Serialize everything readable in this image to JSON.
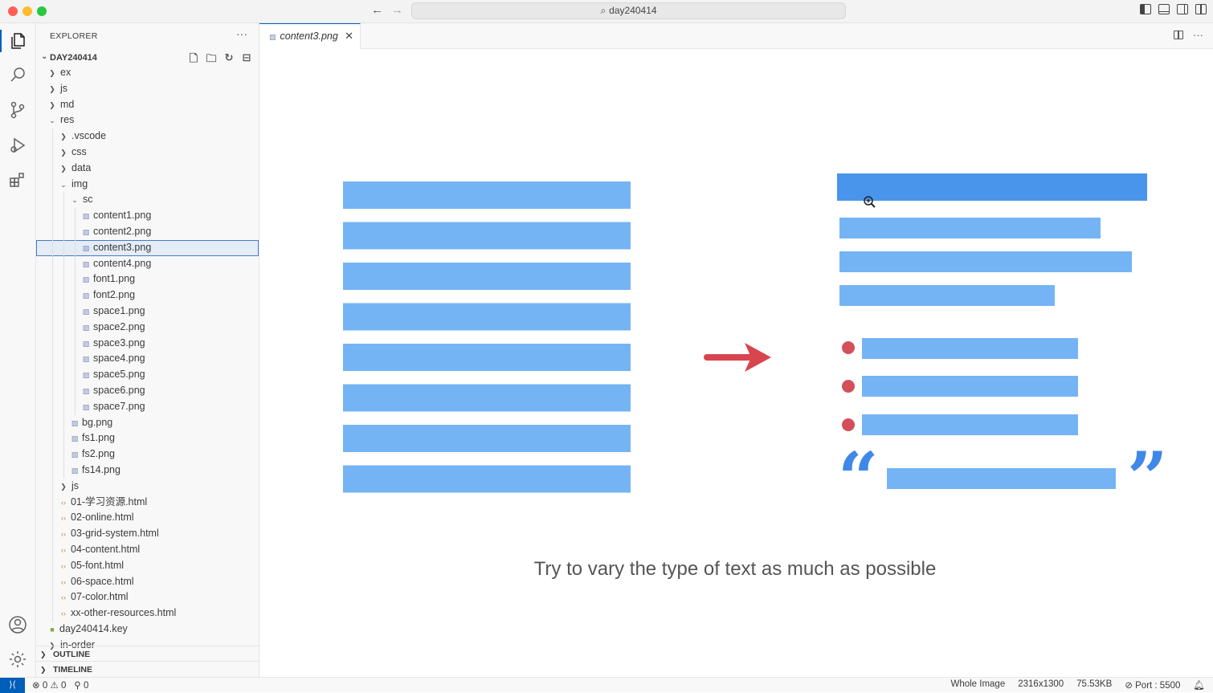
{
  "window": {
    "search_text": "day240414"
  },
  "explorer": {
    "header": "EXPLORER",
    "more": "···",
    "root_label": "DAY240414",
    "tree": [
      {
        "label": "ex",
        "depth": 1,
        "type": "folder",
        "expanded": false
      },
      {
        "label": "js",
        "depth": 1,
        "type": "folder",
        "expanded": false
      },
      {
        "label": "md",
        "depth": 1,
        "type": "folder",
        "expanded": false
      },
      {
        "label": "res",
        "depth": 1,
        "type": "folder",
        "expanded": true
      },
      {
        "label": ".vscode",
        "depth": 2,
        "type": "folder",
        "expanded": false
      },
      {
        "label": "css",
        "depth": 2,
        "type": "folder",
        "expanded": false
      },
      {
        "label": "data",
        "depth": 2,
        "type": "folder",
        "expanded": false
      },
      {
        "label": "img",
        "depth": 2,
        "type": "folder",
        "expanded": true
      },
      {
        "label": "sc",
        "depth": 3,
        "type": "folder",
        "expanded": true
      },
      {
        "label": "content1.png",
        "depth": 4,
        "type": "img"
      },
      {
        "label": "content2.png",
        "depth": 4,
        "type": "img"
      },
      {
        "label": "content3.png",
        "depth": 4,
        "type": "img",
        "selected": true
      },
      {
        "label": "content4.png",
        "depth": 4,
        "type": "img"
      },
      {
        "label": "font1.png",
        "depth": 4,
        "type": "img"
      },
      {
        "label": "font2.png",
        "depth": 4,
        "type": "img"
      },
      {
        "label": "space1.png",
        "depth": 4,
        "type": "img"
      },
      {
        "label": "space2.png",
        "depth": 4,
        "type": "img"
      },
      {
        "label": "space3.png",
        "depth": 4,
        "type": "img"
      },
      {
        "label": "space4.png",
        "depth": 4,
        "type": "img"
      },
      {
        "label": "space5.png",
        "depth": 4,
        "type": "img"
      },
      {
        "label": "space6.png",
        "depth": 4,
        "type": "img"
      },
      {
        "label": "space7.png",
        "depth": 4,
        "type": "img"
      },
      {
        "label": "bg.png",
        "depth": 3,
        "type": "img"
      },
      {
        "label": "fs1.png",
        "depth": 3,
        "type": "img"
      },
      {
        "label": "fs2.png",
        "depth": 3,
        "type": "img"
      },
      {
        "label": "fs14.png",
        "depth": 3,
        "type": "img"
      },
      {
        "label": "js",
        "depth": 2,
        "type": "folder",
        "expanded": false
      },
      {
        "label": "01-学习资源.html",
        "depth": 2,
        "type": "html"
      },
      {
        "label": "02-online.html",
        "depth": 2,
        "type": "html"
      },
      {
        "label": "03-grid-system.html",
        "depth": 2,
        "type": "html"
      },
      {
        "label": "04-content.html",
        "depth": 2,
        "type": "html"
      },
      {
        "label": "05-font.html",
        "depth": 2,
        "type": "html"
      },
      {
        "label": "06-space.html",
        "depth": 2,
        "type": "html"
      },
      {
        "label": "07-color.html",
        "depth": 2,
        "type": "html"
      },
      {
        "label": "xx-other-resources.html",
        "depth": 2,
        "type": "html"
      },
      {
        "label": "day240414.key",
        "depth": 1,
        "type": "key"
      },
      {
        "label": "in-order",
        "depth": 1,
        "type": "folder",
        "expanded": false
      }
    ],
    "outline_label": "OUTLINE",
    "timeline_label": "TIMELINE"
  },
  "editor": {
    "tab_label": "content3.png",
    "image_caption": "Try to vary the type of text as much as possible",
    "colors": {
      "bar": "#74b4f4",
      "bar_highlight": "#4a95ec",
      "bullet": "#d3505a",
      "arrow": "#d7454f",
      "quote": "#3f88e8"
    }
  },
  "statusbar": {
    "errors": "0",
    "warnings": "0",
    "ports": "0",
    "zoom": "Whole Image",
    "dimensions": "2316x1300",
    "size": "75.53KB",
    "port": "Port : 5500"
  }
}
